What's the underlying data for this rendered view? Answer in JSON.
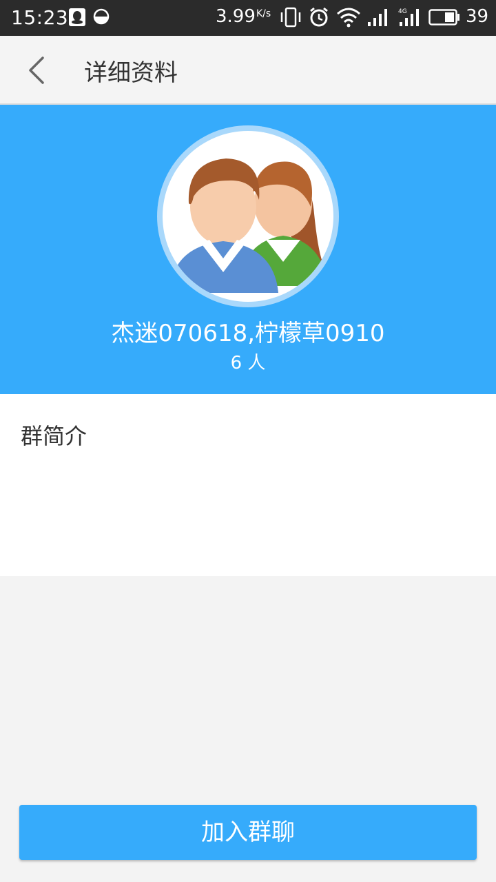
{
  "status_bar": {
    "time": "15:23",
    "speed": "3.99",
    "speed_unit": "K/s",
    "network": "4G",
    "battery": "39"
  },
  "header": {
    "title": "详细资料"
  },
  "profile": {
    "group_name": "杰迷070618,柠檬草0910",
    "member_count": "6 人"
  },
  "intro": {
    "title": "群简介",
    "content": ""
  },
  "actions": {
    "join_label": "加入群聊"
  },
  "colors": {
    "accent": "#36abfb",
    "status_bar": "#2b2b2b",
    "background": "#f3f3f3"
  }
}
